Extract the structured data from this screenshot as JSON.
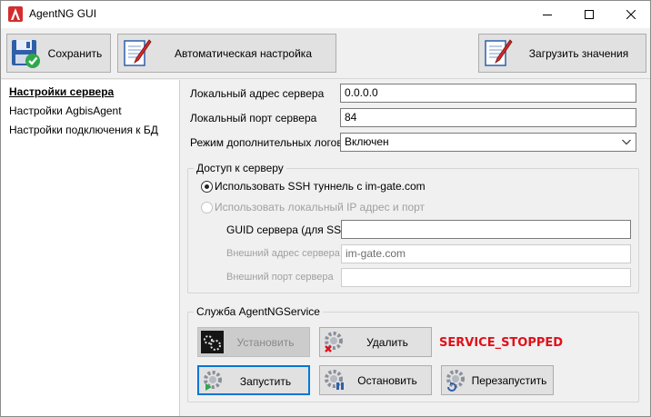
{
  "window": {
    "title": "AgentNG GUI"
  },
  "toolbar": {
    "save_label": "Сохранить",
    "auto_label": "Автоматическая настройка",
    "load_label": "Загрузить значения"
  },
  "sidebar": {
    "items": [
      {
        "label": "Настройки сервера",
        "active": true
      },
      {
        "label": "Настройки AgbisAgent",
        "active": false
      },
      {
        "label": "Настройки подключения к БД",
        "active": false
      }
    ]
  },
  "server": {
    "local_address_label": "Локальный адрес сервера",
    "local_address_value": "0.0.0.0",
    "local_port_label": "Локальный порт сервера",
    "local_port_value": "84",
    "log_mode_label": "Режим дополнительных логов",
    "log_mode_value": "Включен"
  },
  "access": {
    "title": "Доступ к серверу",
    "option_ssh": "Использовать SSH туннель с im-gate.com",
    "option_local": "Использовать локальный IP адрес и порт",
    "guid_label": "GUID сервера (для SSH)",
    "guid_value": "",
    "ext_address_label": "Внешний адрес сервера",
    "ext_address_value": "im-gate.com",
    "ext_port_label": "Внешний порт сервера",
    "ext_port_value": ""
  },
  "service": {
    "title": "Служба AgentNGService",
    "install_label": "Установить",
    "delete_label": "Удалить",
    "status": "SERVICE_STOPPED",
    "status_color": "#e0101a",
    "start_label": "Запустить",
    "stop_label": "Остановить",
    "restart_label": "Перезапустить"
  },
  "colors": {
    "accent": "#0078d7",
    "app_icon": "#d32d2d"
  }
}
